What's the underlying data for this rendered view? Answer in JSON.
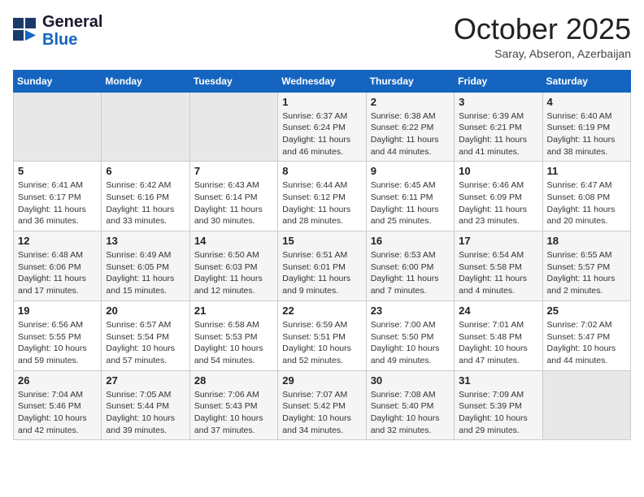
{
  "header": {
    "logo_general": "General",
    "logo_blue": "Blue",
    "month_title": "October 2025",
    "location": "Saray, Abseron, Azerbaijan"
  },
  "calendar": {
    "days_of_week": [
      "Sunday",
      "Monday",
      "Tuesday",
      "Wednesday",
      "Thursday",
      "Friday",
      "Saturday"
    ],
    "weeks": [
      [
        {
          "day": "",
          "info": ""
        },
        {
          "day": "",
          "info": ""
        },
        {
          "day": "",
          "info": ""
        },
        {
          "day": "1",
          "info": "Sunrise: 6:37 AM\nSunset: 6:24 PM\nDaylight: 11 hours and 46 minutes."
        },
        {
          "day": "2",
          "info": "Sunrise: 6:38 AM\nSunset: 6:22 PM\nDaylight: 11 hours and 44 minutes."
        },
        {
          "day": "3",
          "info": "Sunrise: 6:39 AM\nSunset: 6:21 PM\nDaylight: 11 hours and 41 minutes."
        },
        {
          "day": "4",
          "info": "Sunrise: 6:40 AM\nSunset: 6:19 PM\nDaylight: 11 hours and 38 minutes."
        }
      ],
      [
        {
          "day": "5",
          "info": "Sunrise: 6:41 AM\nSunset: 6:17 PM\nDaylight: 11 hours and 36 minutes."
        },
        {
          "day": "6",
          "info": "Sunrise: 6:42 AM\nSunset: 6:16 PM\nDaylight: 11 hours and 33 minutes."
        },
        {
          "day": "7",
          "info": "Sunrise: 6:43 AM\nSunset: 6:14 PM\nDaylight: 11 hours and 30 minutes."
        },
        {
          "day": "8",
          "info": "Sunrise: 6:44 AM\nSunset: 6:12 PM\nDaylight: 11 hours and 28 minutes."
        },
        {
          "day": "9",
          "info": "Sunrise: 6:45 AM\nSunset: 6:11 PM\nDaylight: 11 hours and 25 minutes."
        },
        {
          "day": "10",
          "info": "Sunrise: 6:46 AM\nSunset: 6:09 PM\nDaylight: 11 hours and 23 minutes."
        },
        {
          "day": "11",
          "info": "Sunrise: 6:47 AM\nSunset: 6:08 PM\nDaylight: 11 hours and 20 minutes."
        }
      ],
      [
        {
          "day": "12",
          "info": "Sunrise: 6:48 AM\nSunset: 6:06 PM\nDaylight: 11 hours and 17 minutes."
        },
        {
          "day": "13",
          "info": "Sunrise: 6:49 AM\nSunset: 6:05 PM\nDaylight: 11 hours and 15 minutes."
        },
        {
          "day": "14",
          "info": "Sunrise: 6:50 AM\nSunset: 6:03 PM\nDaylight: 11 hours and 12 minutes."
        },
        {
          "day": "15",
          "info": "Sunrise: 6:51 AM\nSunset: 6:01 PM\nDaylight: 11 hours and 9 minutes."
        },
        {
          "day": "16",
          "info": "Sunrise: 6:53 AM\nSunset: 6:00 PM\nDaylight: 11 hours and 7 minutes."
        },
        {
          "day": "17",
          "info": "Sunrise: 6:54 AM\nSunset: 5:58 PM\nDaylight: 11 hours and 4 minutes."
        },
        {
          "day": "18",
          "info": "Sunrise: 6:55 AM\nSunset: 5:57 PM\nDaylight: 11 hours and 2 minutes."
        }
      ],
      [
        {
          "day": "19",
          "info": "Sunrise: 6:56 AM\nSunset: 5:55 PM\nDaylight: 10 hours and 59 minutes."
        },
        {
          "day": "20",
          "info": "Sunrise: 6:57 AM\nSunset: 5:54 PM\nDaylight: 10 hours and 57 minutes."
        },
        {
          "day": "21",
          "info": "Sunrise: 6:58 AM\nSunset: 5:53 PM\nDaylight: 10 hours and 54 minutes."
        },
        {
          "day": "22",
          "info": "Sunrise: 6:59 AM\nSunset: 5:51 PM\nDaylight: 10 hours and 52 minutes."
        },
        {
          "day": "23",
          "info": "Sunrise: 7:00 AM\nSunset: 5:50 PM\nDaylight: 10 hours and 49 minutes."
        },
        {
          "day": "24",
          "info": "Sunrise: 7:01 AM\nSunset: 5:48 PM\nDaylight: 10 hours and 47 minutes."
        },
        {
          "day": "25",
          "info": "Sunrise: 7:02 AM\nSunset: 5:47 PM\nDaylight: 10 hours and 44 minutes."
        }
      ],
      [
        {
          "day": "26",
          "info": "Sunrise: 7:04 AM\nSunset: 5:46 PM\nDaylight: 10 hours and 42 minutes."
        },
        {
          "day": "27",
          "info": "Sunrise: 7:05 AM\nSunset: 5:44 PM\nDaylight: 10 hours and 39 minutes."
        },
        {
          "day": "28",
          "info": "Sunrise: 7:06 AM\nSunset: 5:43 PM\nDaylight: 10 hours and 37 minutes."
        },
        {
          "day": "29",
          "info": "Sunrise: 7:07 AM\nSunset: 5:42 PM\nDaylight: 10 hours and 34 minutes."
        },
        {
          "day": "30",
          "info": "Sunrise: 7:08 AM\nSunset: 5:40 PM\nDaylight: 10 hours and 32 minutes."
        },
        {
          "day": "31",
          "info": "Sunrise: 7:09 AM\nSunset: 5:39 PM\nDaylight: 10 hours and 29 minutes."
        },
        {
          "day": "",
          "info": ""
        }
      ]
    ]
  }
}
